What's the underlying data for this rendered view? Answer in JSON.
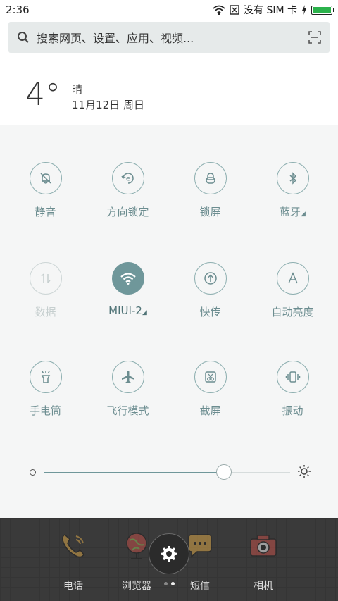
{
  "status_bar": {
    "time": "2:36",
    "carrier": "没有 SIM 卡",
    "battery_level": 1.0,
    "battery_color": "#2bb24c"
  },
  "search": {
    "placeholder": "搜索网页、设置、应用、视频..."
  },
  "weather": {
    "temp": "4°",
    "condition": "晴",
    "date": "11月12日 周日"
  },
  "toggles": [
    {
      "label": "静音",
      "icon": "bell-off-icon",
      "state": "off"
    },
    {
      "label": "方向锁定",
      "icon": "rotation-lock-icon",
      "state": "off"
    },
    {
      "label": "锁屏",
      "icon": "lock-icon",
      "state": "off"
    },
    {
      "label": "蓝牙",
      "icon": "bluetooth-icon",
      "state": "off"
    },
    {
      "label": "数据",
      "icon": "data-icon",
      "state": "disabled"
    },
    {
      "label": "MIUI-2",
      "icon": "wifi-icon",
      "state": "on"
    },
    {
      "label": "快传",
      "icon": "share-icon",
      "state": "off"
    },
    {
      "label": "自动亮度",
      "icon": "auto-brightness-icon",
      "state": "off"
    },
    {
      "label": "手电筒",
      "icon": "flashlight-icon",
      "state": "off"
    },
    {
      "label": "飞行模式",
      "icon": "airplane-icon",
      "state": "off"
    },
    {
      "label": "截屏",
      "icon": "screenshot-icon",
      "state": "off"
    },
    {
      "label": "振动",
      "icon": "vibrate-icon",
      "state": "off"
    }
  ],
  "brightness": {
    "level": 0.73,
    "accent": "#6f979a"
  },
  "dock": {
    "apps": [
      {
        "label": "电话",
        "icon": "phone-icon"
      },
      {
        "label": "浏览器",
        "icon": "browser-icon"
      },
      {
        "label": "短信",
        "icon": "message-icon"
      },
      {
        "label": "相机",
        "icon": "camera-icon"
      }
    ],
    "settings_icon": "gear-icon",
    "pages": 2,
    "active_page": 2
  }
}
